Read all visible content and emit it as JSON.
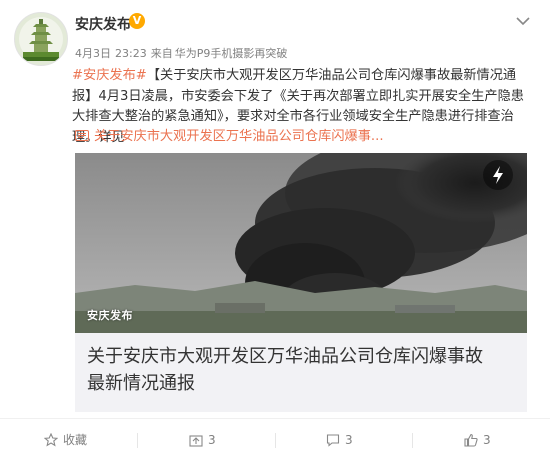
{
  "post": {
    "author": "安庆发布",
    "verified_badge": "V",
    "date": "4月3日",
    "time": "23:23",
    "source_prefix": "来自",
    "source": "华为P9手机摄影再突破",
    "hashtag": "#安庆发布#",
    "text_title": "【关于安庆市大观开发区万华油品公司仓库闪爆事故最新情况通报】",
    "text_body": "4月3日凌晨，市安委会下发了《关于再次部署立即扎实开展安全生产隐患大排查大整治的紧急通知》，要求对全市各行业领域安全生产隐患进行排查治理。",
    "text_more": "详见",
    "link_text": "关于安庆市大观开发区万华油品公司仓库闪爆事...",
    "media_watermark": "安庆发布",
    "card_caption": "关于安庆市大观开发区万华油品公司仓库闪爆事故最新情况通报"
  },
  "actions": {
    "favorite_label": "收藏",
    "repost_count": "3",
    "comment_count": "3",
    "like_count": "3"
  },
  "colors": {
    "link": "#eb7350",
    "text": "#333333",
    "meta": "#808080",
    "badge": "#ffa900",
    "caption_bg": "#f2f2f5"
  },
  "icons": [
    "caret-down-icon",
    "link-icon",
    "play-icon",
    "star-icon",
    "repost-icon",
    "comment-icon",
    "like-icon"
  ]
}
